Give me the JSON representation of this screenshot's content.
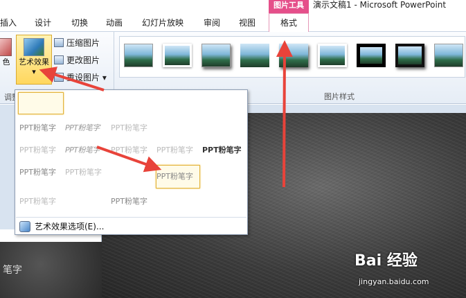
{
  "title_bar": {
    "context_tab_group": "图片工具",
    "app_title": "演示文稿1 - Microsoft PowerPoint"
  },
  "tabs": [
    "插入",
    "设计",
    "切换",
    "动画",
    "幻灯片放映",
    "审阅",
    "视图",
    "格式"
  ],
  "active_tab": "格式",
  "ribbon": {
    "color_button": "色",
    "artistic_effects_button": "艺术效果",
    "dropdown_caret": "▾",
    "compress_pictures": "压缩图片",
    "change_picture": "更改图片",
    "reset_picture": "重设图片",
    "reset_caret": "▾",
    "adjust_group_label": "调整",
    "picture_styles_label": "图片样式"
  },
  "artistic_effects_menu": {
    "effect_text": "PPT粉笔字",
    "options_link": "艺术效果选项(E)..."
  },
  "slide_pane": {
    "thumb_text": "笔字"
  },
  "watermark": {
    "brand": "Bai 经验",
    "url": "jingyan.baidu.com"
  },
  "colors": {
    "picture_tools_accent": "#e54f8a",
    "selected_effect_border": "#e2b33c",
    "annotation_arrow": "#e8433a"
  }
}
